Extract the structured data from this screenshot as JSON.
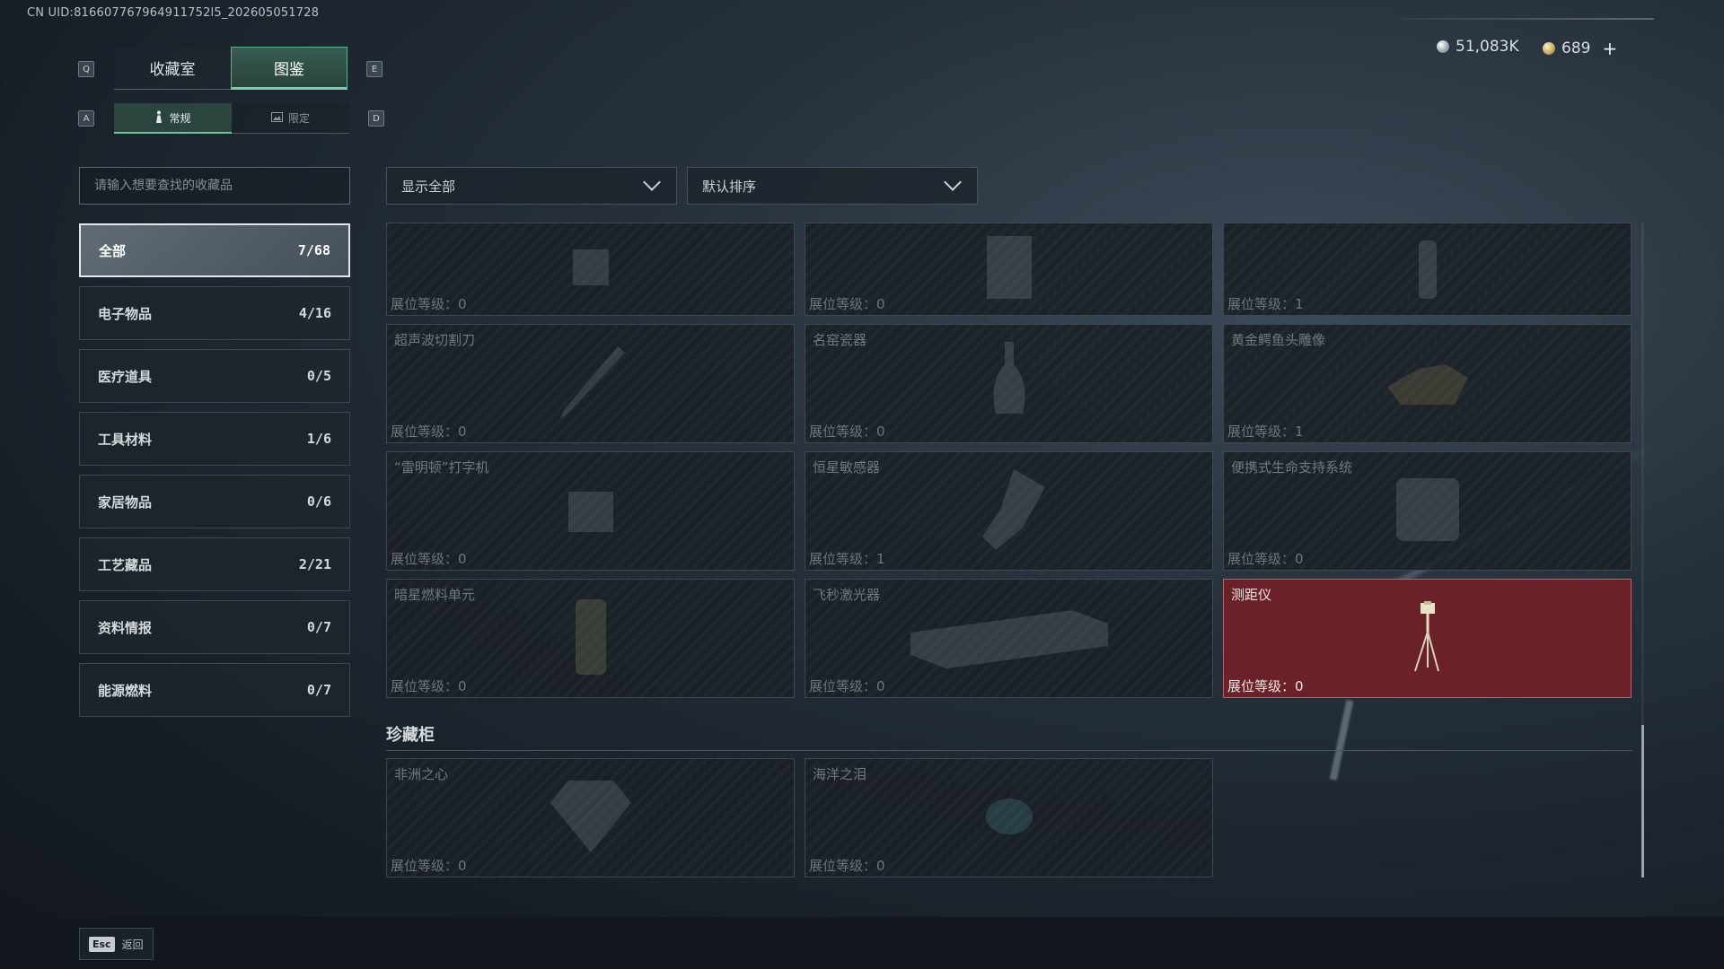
{
  "uid": "CN UID:816607767964911752l5_202605051728",
  "keys": {
    "q": "Q",
    "e": "E",
    "a": "A",
    "d": "D",
    "esc": "Esc"
  },
  "main_tabs": [
    {
      "label": "收藏室",
      "active": false
    },
    {
      "label": "图鉴",
      "active": true
    }
  ],
  "sub_tabs": [
    {
      "label": "常规",
      "icon": "figure-icon",
      "active": true
    },
    {
      "label": "限定",
      "icon": "picture-icon",
      "active": false
    }
  ],
  "currency": {
    "silver": "51,083K",
    "gold": "689",
    "plus": "+"
  },
  "search": {
    "placeholder": "请输入想要查找的收藏品"
  },
  "filters": {
    "show": "显示全部",
    "sort": "默认排序"
  },
  "categories": [
    {
      "label": "全部",
      "count": "7/68",
      "active": true
    },
    {
      "label": "电子物品",
      "count": "4/16"
    },
    {
      "label": "医疗道具",
      "count": "0/5"
    },
    {
      "label": "工具材料",
      "count": "1/6"
    },
    {
      "label": "家居物品",
      "count": "0/6"
    },
    {
      "label": "工艺藏品",
      "count": "2/21"
    },
    {
      "label": "资料情报",
      "count": "0/7"
    },
    {
      "label": "能源燃料",
      "count": "0/7"
    }
  ],
  "level_label": "展位等级：",
  "items": [
    {
      "name": "",
      "level": "0",
      "icon": "device-icon"
    },
    {
      "name": "",
      "level": "0",
      "icon": "machine-icon"
    },
    {
      "name": "",
      "level": "1",
      "icon": "bottle-icon"
    },
    {
      "name": "超声波切割刀",
      "level": "0",
      "icon": "knife-icon"
    },
    {
      "name": "名窑瓷器",
      "level": "0",
      "icon": "vase-icon"
    },
    {
      "name": "黄金鳄鱼头雕像",
      "level": "1",
      "icon": "statue-icon"
    },
    {
      "name": "“雷明顿”打字机",
      "level": "0",
      "icon": "typewriter-icon"
    },
    {
      "name": "恒星敏感器",
      "level": "1",
      "icon": "sensor-icon"
    },
    {
      "name": "便携式生命支持系统",
      "level": "0",
      "icon": "backpack-icon"
    },
    {
      "name": "暗星燃料单元",
      "level": "0",
      "icon": "canister-icon"
    },
    {
      "name": "飞秒激光器",
      "level": "0",
      "icon": "laser-icon"
    },
    {
      "name": "测距仪",
      "level": "0",
      "icon": "tripod-icon",
      "highlight": true
    }
  ],
  "section": {
    "title": "珍藏柜"
  },
  "showcase": [
    {
      "name": "非洲之心",
      "level": "0",
      "icon": "diamond-icon"
    },
    {
      "name": "海洋之泪",
      "level": "0",
      "icon": "gem-icon"
    }
  ],
  "back_label": "返回",
  "colors": {
    "accent": "#74d3a5",
    "highlight": "#6a2228"
  }
}
